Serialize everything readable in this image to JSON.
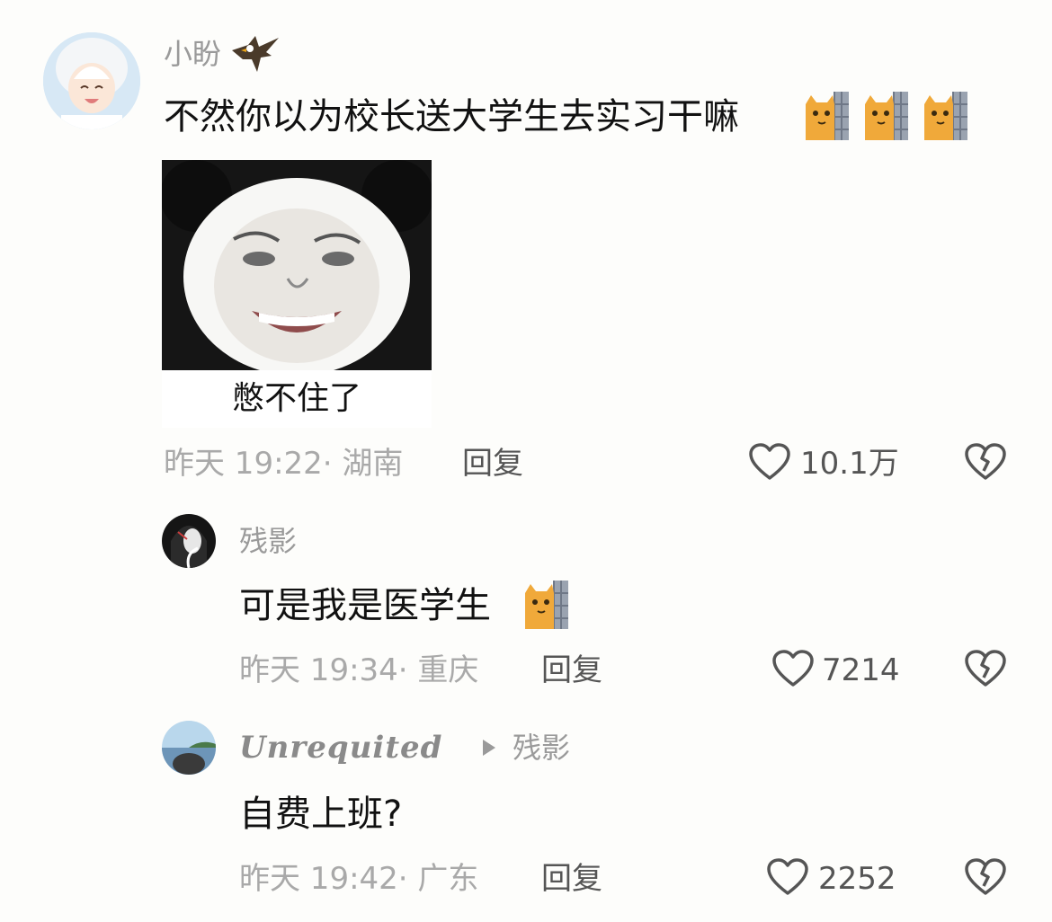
{
  "comments": [
    {
      "username": "小盼",
      "badge_icon": "eagle-icon",
      "text": "不然你以为校长送大学生去实习干嘛",
      "emojis": [
        "cat-peeking-icon",
        "cat-peeking-icon",
        "cat-peeking-icon"
      ],
      "meme_caption": "憋不住了",
      "meta": "昨天 19:22· 湖南",
      "reply_label": "回复",
      "likes": "10.1万"
    },
    {
      "username": "残影",
      "text": "可是我是医学生",
      "emojis": [
        "cat-peeking-icon"
      ],
      "meta": "昨天 19:34· 重庆",
      "reply_label": "回复",
      "likes": "7214"
    },
    {
      "username": "Unrequited",
      "reply_to": "残影",
      "text": "自费上班?",
      "meta": "昨天 19:42· 广东",
      "reply_label": "回复",
      "likes": "2252"
    }
  ],
  "colors": {
    "background": "#fdfdfb",
    "username": "#9a9a9a",
    "meta": "#a9a9a9",
    "content": "#111111"
  }
}
